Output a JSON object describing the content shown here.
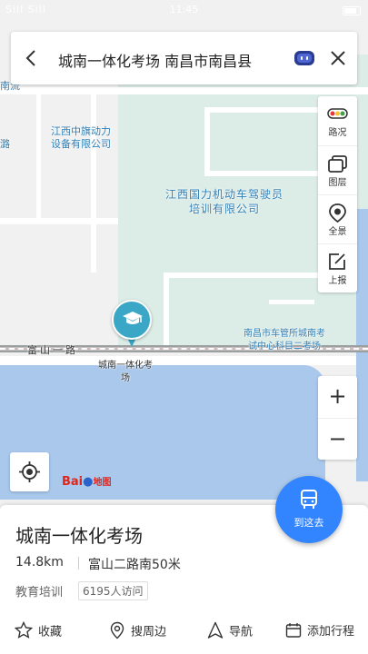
{
  "status_bar": {
    "carrier": "Sill Sill",
    "time": "11:45"
  },
  "search": {
    "title": "城南一体化考场 南昌市南昌县"
  },
  "map": {
    "labels": {
      "top_left_edge": "南流",
      "left_edge": "潞",
      "company_1": "江西中旗动力\n设备有限公司",
      "company_2": "江西国力机动车驾驶员\n培训有限公司",
      "road": "富山一路",
      "poi": "城南一体化考\n场",
      "exam_center": "南昌市车管所城南考\n试中心科目二考场"
    },
    "logo": {
      "text_left": "Bai",
      "text_right": "地图"
    }
  },
  "tools": [
    {
      "icon": "traffic-light-icon",
      "label": "路况"
    },
    {
      "icon": "layers-icon",
      "label": "图层"
    },
    {
      "icon": "panorama-icon",
      "label": "全景"
    },
    {
      "icon": "report-edit-icon",
      "label": "上报"
    }
  ],
  "zoom": {
    "in": "+",
    "out": "−"
  },
  "fab": {
    "label": "到这去"
  },
  "place": {
    "name": "城南一体化考场",
    "distance": "14.8km",
    "address": "富山二路南50米",
    "category": "教育培训",
    "visits": "6195人访问"
  },
  "actions": [
    {
      "icon": "star-icon",
      "label": "收藏"
    },
    {
      "icon": "location-search-icon",
      "label": "搜周边"
    },
    {
      "icon": "navigation-arrow-icon",
      "label": "导航"
    },
    {
      "icon": "calendar-add-icon",
      "label": "添加行程"
    }
  ],
  "colors": {
    "accent": "#3385ff",
    "pin": "#3aa7c6",
    "water": "#a9c8ec",
    "green": "#dcece6"
  }
}
